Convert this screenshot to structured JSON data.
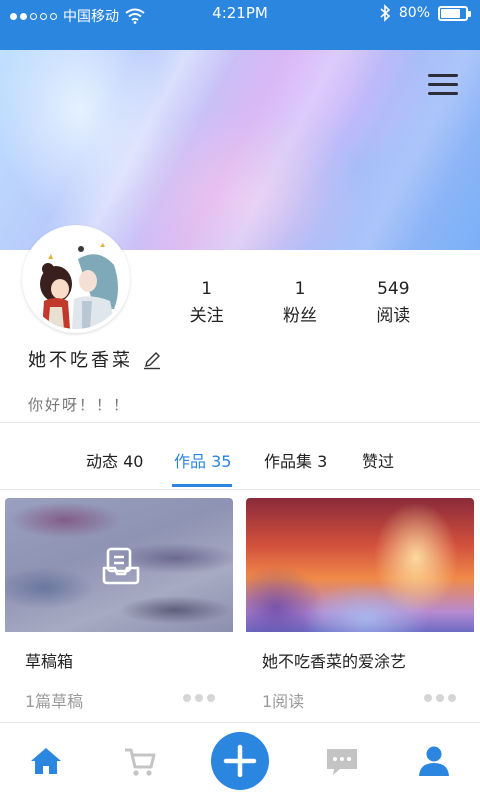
{
  "status_bar": {
    "carrier": "中国移动",
    "time": "4:21PM",
    "battery_percent": "80%",
    "battery_level": 0.8,
    "signal_bars": 2,
    "icons": [
      "wifi-icon",
      "bluetooth-icon",
      "battery-icon"
    ]
  },
  "header": {
    "menu_icon": "menu-icon"
  },
  "profile": {
    "username": "她不吃香菜",
    "bio": "你好呀！！！",
    "stats": [
      {
        "value": "1",
        "label": "关注"
      },
      {
        "value": "1",
        "label": "粉丝"
      },
      {
        "value": "549",
        "label": "阅读"
      }
    ]
  },
  "tabs": [
    {
      "label": "动态 40",
      "active": false
    },
    {
      "label": "作品 35",
      "active": true
    },
    {
      "label": "作品集 3",
      "active": false
    },
    {
      "label": "赞过",
      "active": false
    }
  ],
  "cards": [
    {
      "title": "草稿箱",
      "meta": "1篇草稿",
      "icon": "drafts-icon"
    },
    {
      "title": "她不吃香菜的爱涂艺",
      "meta": "1阅读"
    }
  ],
  "bottom_nav": {
    "items": [
      "home-icon",
      "cart-icon",
      "add-icon",
      "messages-icon",
      "profile-icon"
    ],
    "active": "home-icon"
  },
  "colors": {
    "accent": "#2b86e0",
    "text": "#222222",
    "muted": "#9a9a9a"
  }
}
